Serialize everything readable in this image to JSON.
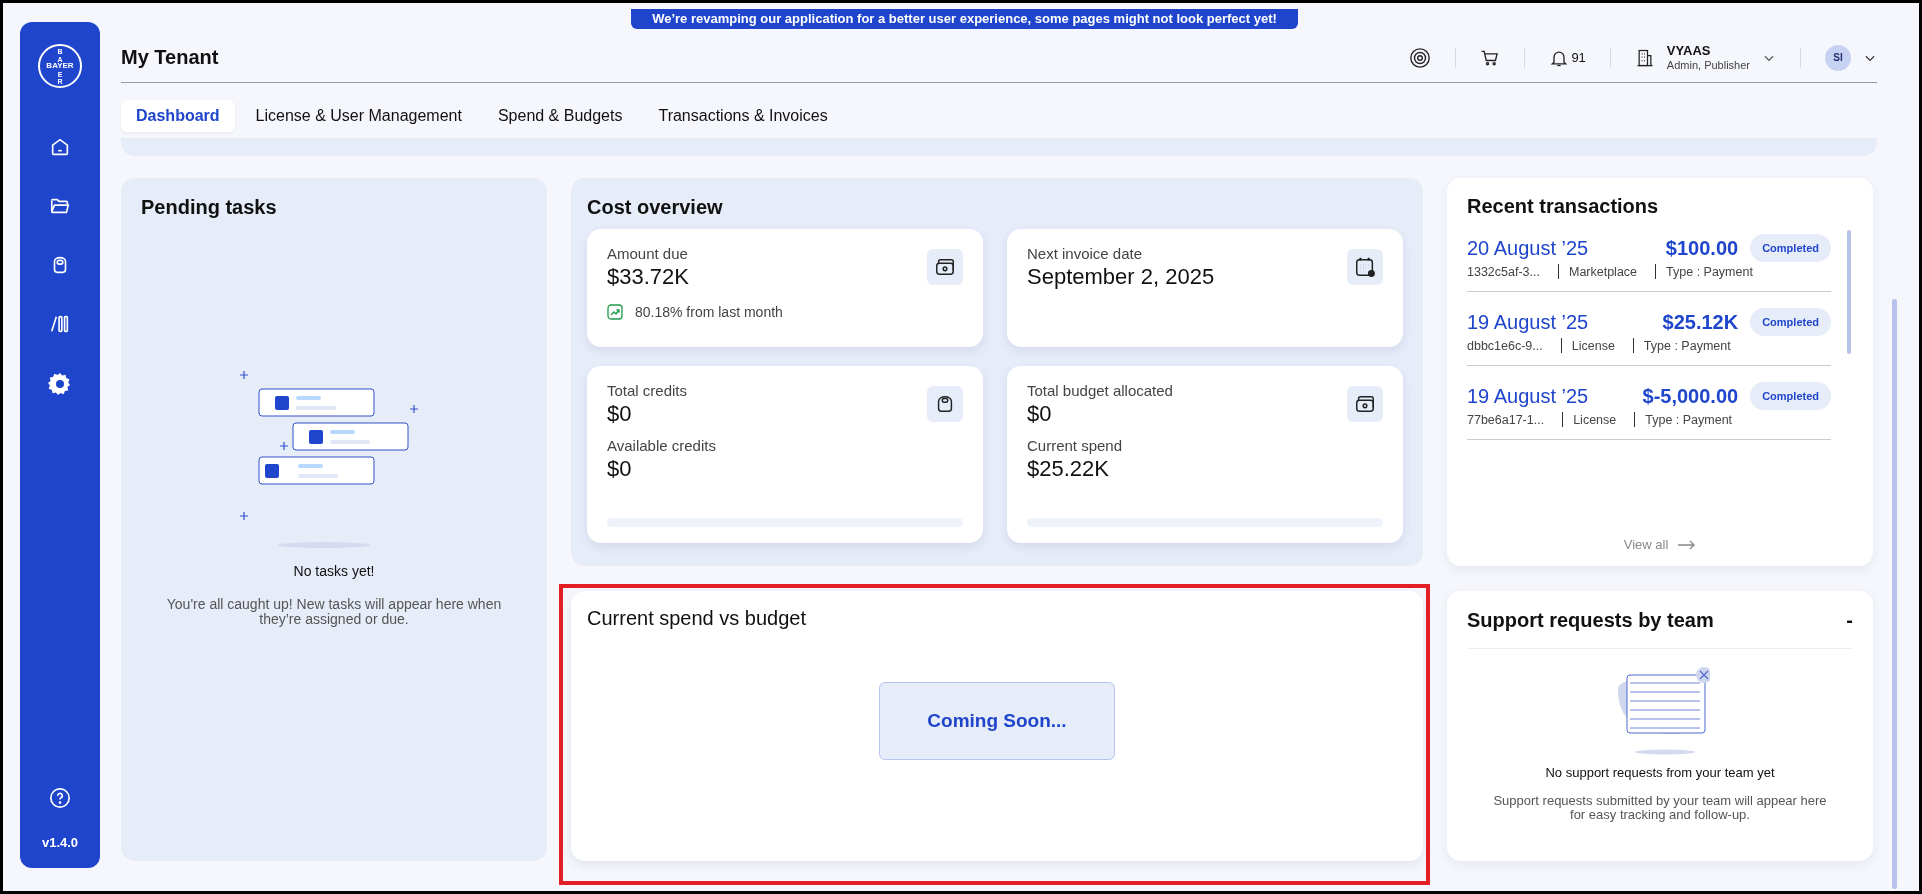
{
  "banner": "We’re revamping our application for a better user experience, some pages might not look perfect yet!",
  "sidebar": {
    "logo": {
      "horizontal": "BAYER",
      "vertical": "BAYER"
    },
    "version": "v1.4.0"
  },
  "header": {
    "title": "My Tenant",
    "notifications": "91",
    "user": {
      "name": "VYAAS",
      "roles": "Admin, Publisher",
      "initials": "SI"
    }
  },
  "tabs": [
    {
      "label": "Dashboard",
      "selected": true
    },
    {
      "label": "License & User Management",
      "selected": false
    },
    {
      "label": "Spend & Budgets",
      "selected": false
    },
    {
      "label": "Transactions & Invoices",
      "selected": false
    }
  ],
  "pending_tasks": {
    "title": "Pending tasks",
    "empty_title": "No tasks yet!",
    "empty_text": "You're all caught up! New tasks will appear here when they’re assigned or due."
  },
  "cost_overview": {
    "title": "Cost overview",
    "cards": [
      {
        "kind": "amount",
        "label": "Amount due",
        "value": "$33.72K",
        "trend": "80.18% from last month"
      },
      {
        "kind": "date",
        "label": "Next invoice date",
        "value": "September 2, 2025"
      },
      {
        "kind": "credits",
        "label": "Total credits",
        "value": "$0",
        "second_label": "Available credits",
        "second_value": "$0",
        "level": 0
      },
      {
        "kind": "budget",
        "label": "Total budget allocated",
        "value": "$0",
        "second_label": "Current spend",
        "second_value": "$25.22K",
        "level": 0
      }
    ]
  },
  "spend_vs_budget": {
    "title": "Current spend vs budget",
    "notice": "Coming Soon...",
    "highlighted": true
  },
  "recent_transactions": {
    "title": "Recent transactions",
    "view_all": "View all",
    "rows": [
      {
        "date": "20 August ’25",
        "amount": "$100.00",
        "status": "Completed",
        "id": "1332c5af-3...",
        "category": "Marketplace",
        "type": "Type : Payment"
      },
      {
        "date": "19 August ’25",
        "amount": "$25.12K",
        "status": "Completed",
        "id": "dbbc1e6c-9...",
        "category": "License",
        "type": "Type : Payment"
      },
      {
        "date": "19 August ’25",
        "amount": "$-5,000.00",
        "status": "Completed",
        "id": "77be6a17-1...",
        "category": "License",
        "type": "Type : Payment"
      }
    ]
  },
  "support_requests": {
    "title": "Support requests by team",
    "value": "-",
    "empty_title": "No support requests from your team yet",
    "empty_text": "Support requests submitted by your team will appear here for easy tracking and follow-up."
  }
}
